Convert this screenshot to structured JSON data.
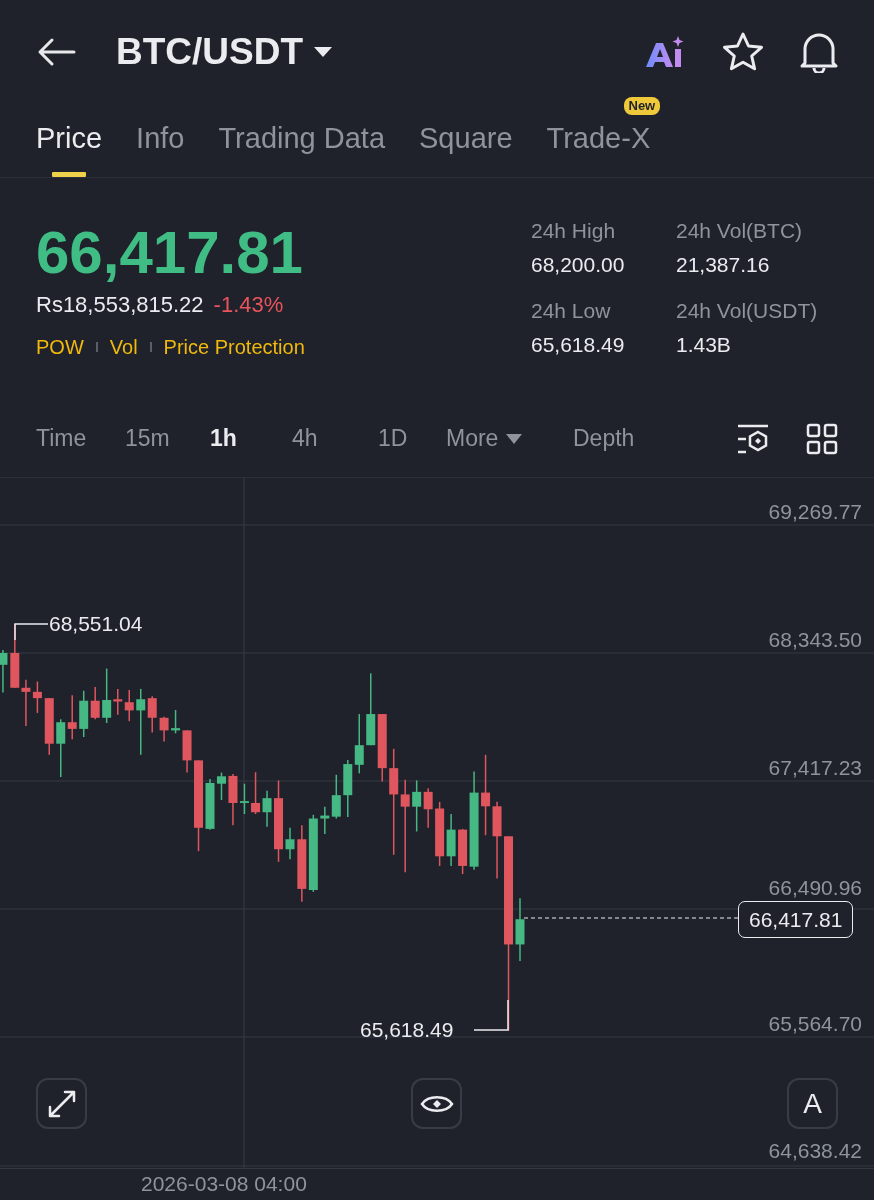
{
  "header": {
    "pair": "BTC/USDT"
  },
  "tabs": [
    {
      "label": "Price",
      "selected": true
    },
    {
      "label": "Info",
      "selected": false
    },
    {
      "label": "Trading Data",
      "selected": false
    },
    {
      "label": "Square",
      "selected": false
    },
    {
      "label": "Trade-X",
      "selected": false,
      "badge": "New"
    }
  ],
  "ticker": {
    "last_price": "66,417.81",
    "local_price": "Rs18,553,815.22",
    "change": "-1.43%",
    "tags": [
      "POW",
      "Vol",
      "Price Protection"
    ],
    "stats": [
      {
        "label": "24h High",
        "value": "68,200.00"
      },
      {
        "label": "24h Vol(BTC)",
        "value": "21,387.16"
      },
      {
        "label": "24h Low",
        "value": "65,618.49"
      },
      {
        "label": "24h Vol(USDT)",
        "value": "1.43B"
      }
    ]
  },
  "intervals": [
    {
      "label": "Time",
      "selected": false,
      "kind": "interval"
    },
    {
      "label": "15m",
      "selected": false,
      "kind": "interval"
    },
    {
      "label": "1h",
      "selected": true,
      "kind": "interval"
    },
    {
      "label": "4h",
      "selected": false,
      "kind": "interval"
    },
    {
      "label": "1D",
      "selected": false,
      "kind": "interval"
    },
    {
      "label": "More",
      "selected": false,
      "kind": "dropdown"
    },
    {
      "label": "Depth",
      "selected": false,
      "kind": "interval"
    }
  ],
  "chart": {
    "price_ticks": [
      "69,269.77",
      "68,343.50",
      "67,417.23",
      "66,490.96",
      "65,564.70",
      "64,638.42"
    ],
    "high_marker": "68,551.04",
    "low_marker": "65,618.49",
    "current_price": "66,417.81",
    "time_label": "2026-03-08 04:00",
    "mode_button": "A"
  }
}
